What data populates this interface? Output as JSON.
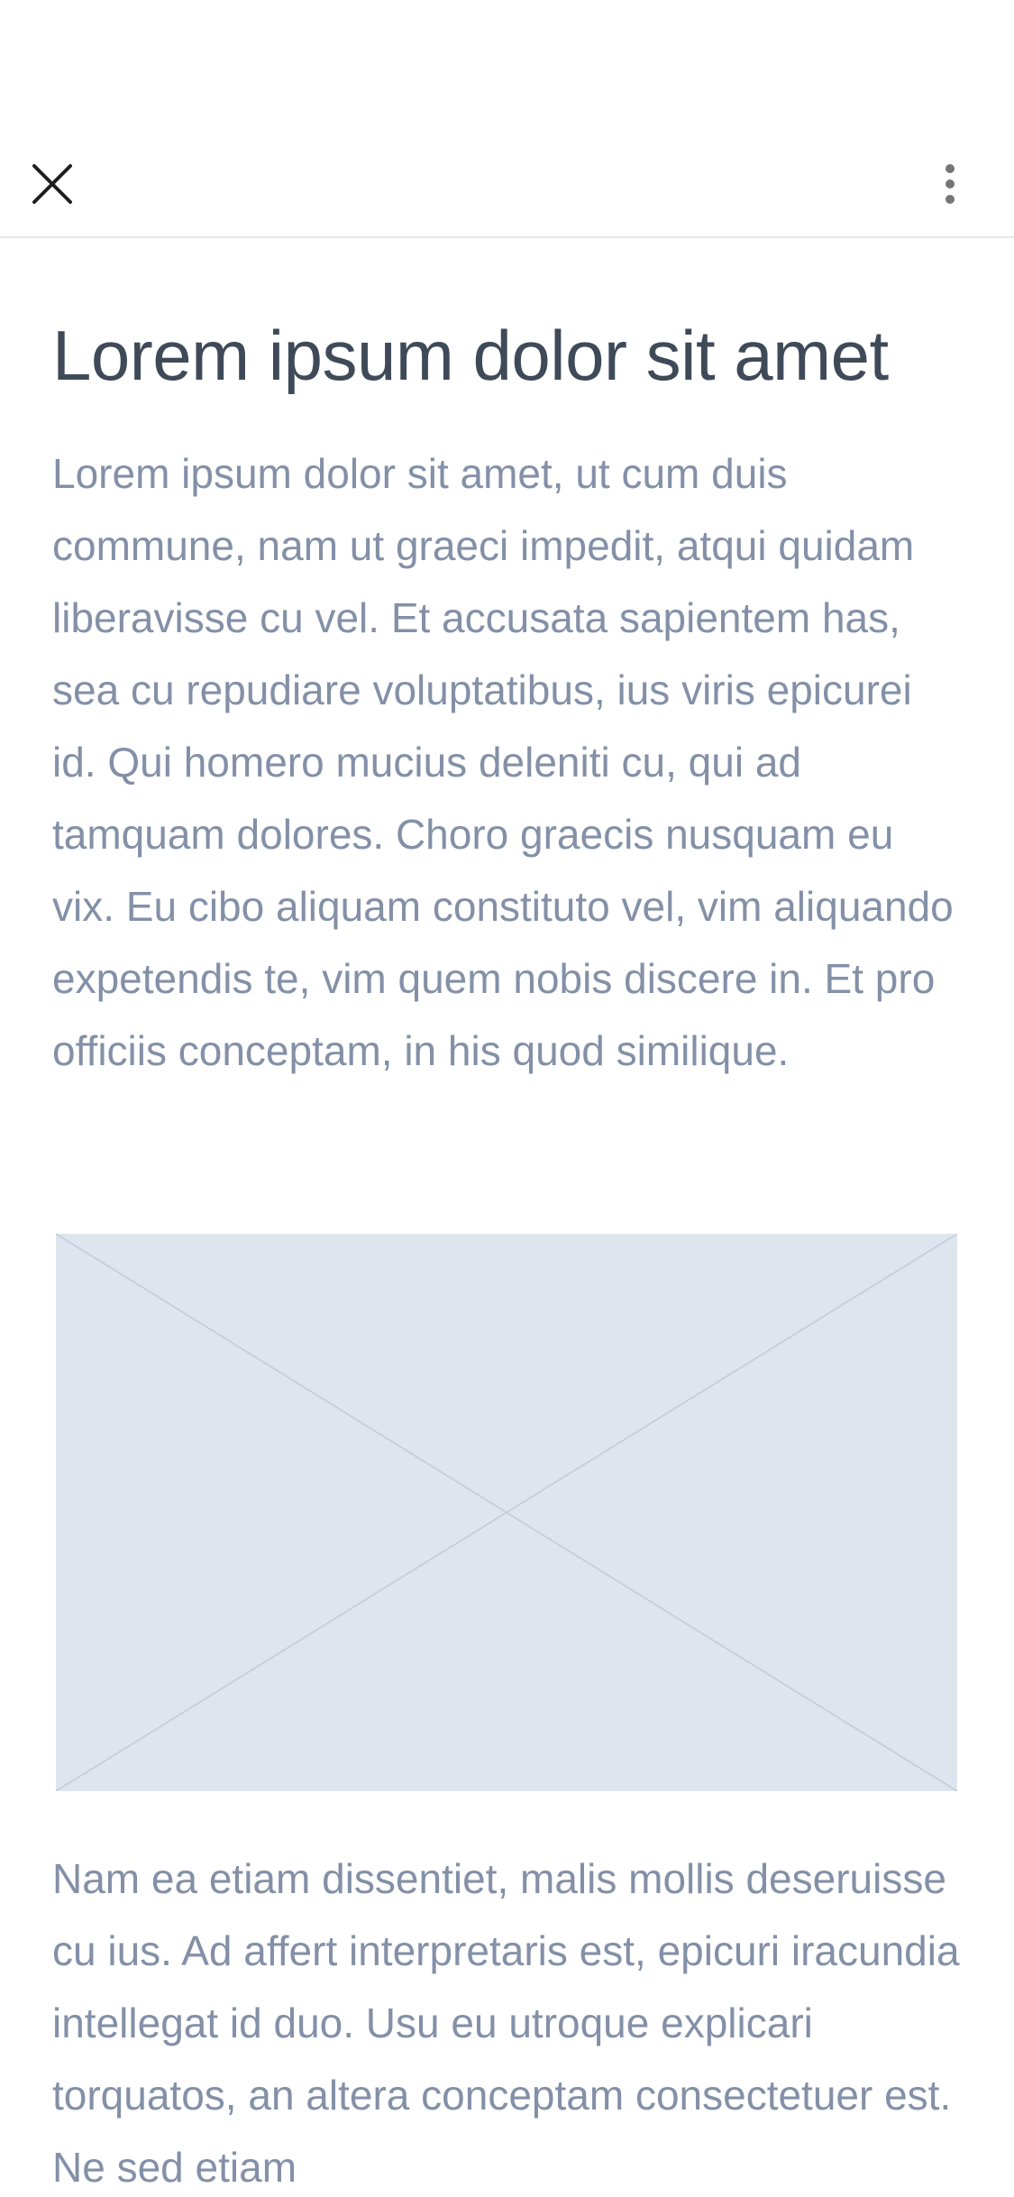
{
  "icons": {
    "close": "close-icon",
    "more": "more-vertical-icon",
    "image_placeholder": "image-placeholder-icon"
  },
  "colors": {
    "title": "#3f4a59",
    "body_text": "#8390a7",
    "placeholder_bg": "#dfe5ee",
    "placeholder_lines": "#c3cad8",
    "divider": "#e5e7eb"
  },
  "article": {
    "title": "Lorem ipsum dolor sit amet",
    "paragraph_1": "Lorem ipsum dolor sit amet, ut cum duis commune, nam ut graeci impedit, atqui quidam liberavisse cu vel. Et accusata sapientem has, sea cu repudiare voluptatibus, ius viris epicurei id. Qui homero mucius deleniti cu, qui ad tamquam dolores. Choro graecis nusquam eu vix. Eu cibo aliquam constituto vel, vim aliquando expetendis te, vim quem nobis discere in. Et pro officiis conceptam, in his quod similique.",
    "paragraph_2": "Nam ea etiam dissentiet, malis mollis deseruisse cu ius. Ad affert interpretaris est, epicuri iracundia intellegat id duo. Usu eu utroque explicari torquatos, an altera conceptam consectetuer est. Ne sed etiam"
  }
}
